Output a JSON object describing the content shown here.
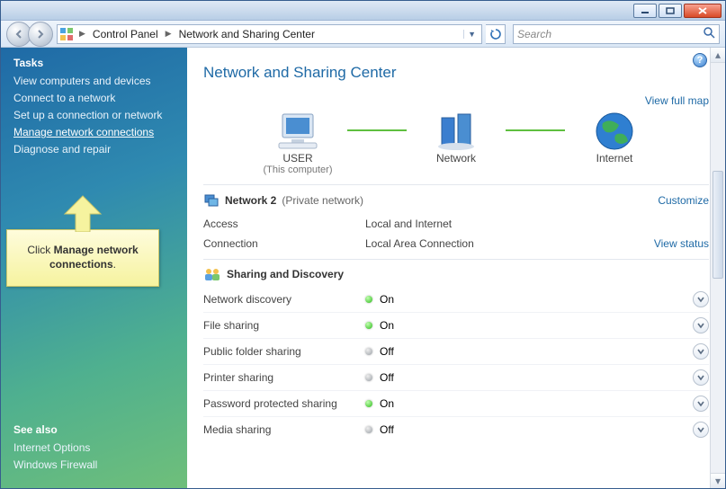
{
  "address": {
    "crumb1": "Control Panel",
    "crumb2": "Network and Sharing Center"
  },
  "search": {
    "placeholder": "Search"
  },
  "sidebar": {
    "tasks_heading": "Tasks",
    "items": [
      "View computers and devices",
      "Connect to a network",
      "Set up a connection or network",
      "Manage network connections",
      "Diagnose and repair"
    ],
    "seealso_heading": "See also",
    "seealso": [
      "Internet Options",
      "Windows Firewall"
    ]
  },
  "callout": {
    "prefix": "Click ",
    "bold": "Manage network connections",
    "suffix": "."
  },
  "page": {
    "title": "Network and Sharing Center",
    "view_full_map": "View full map",
    "nodes": {
      "computer": "USER",
      "computer_sub": "(This computer)",
      "network": "Network",
      "internet": "Internet"
    },
    "network_section": {
      "label_prefix": "Network  2",
      "label_suffix": "(Private network)",
      "customize": "Customize",
      "rows": {
        "access_k": "Access",
        "access_v": "Local and Internet",
        "conn_k": "Connection",
        "conn_v": "Local Area Connection",
        "view_status": "View status"
      }
    },
    "sharing_section": {
      "heading": "Sharing and Discovery",
      "rows": [
        {
          "k": "Network discovery",
          "on": true,
          "v": "On"
        },
        {
          "k": "File sharing",
          "on": true,
          "v": "On"
        },
        {
          "k": "Public folder sharing",
          "on": false,
          "v": "Off"
        },
        {
          "k": "Printer sharing",
          "on": false,
          "v": "Off"
        },
        {
          "k": "Password protected sharing",
          "on": true,
          "v": "On"
        },
        {
          "k": "Media sharing",
          "on": false,
          "v": "Off"
        }
      ]
    }
  }
}
